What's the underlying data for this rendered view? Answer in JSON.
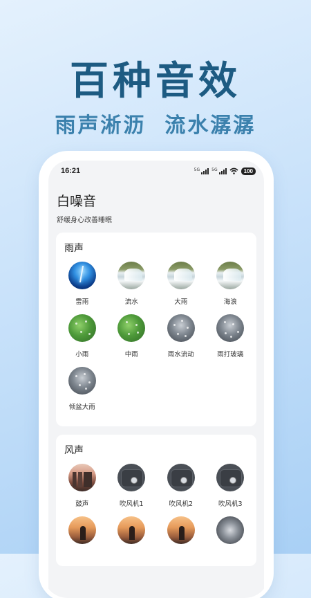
{
  "promo": {
    "headline": "百种音效",
    "subline": "雨声淅沥  流水潺潺"
  },
  "status_bar": {
    "time": "16:21",
    "signal_1_label": "5G",
    "signal_2_label": "5G",
    "battery": "100"
  },
  "app": {
    "title": "白噪音",
    "subtitle": "舒缓身心改善睡眠"
  },
  "sections": [
    {
      "title": "雨声",
      "items": [
        {
          "label": "雷雨",
          "icon": "thunderstorm-thumbnail"
        },
        {
          "label": "流水",
          "icon": "waterfall-thumbnail"
        },
        {
          "label": "大雨",
          "icon": "waterfall-thumbnail"
        },
        {
          "label": "海浪",
          "icon": "waterfall-thumbnail"
        },
        {
          "label": "小雨",
          "icon": "green-leaf-thumbnail"
        },
        {
          "label": "中雨",
          "icon": "green-leaf-thumbnail"
        },
        {
          "label": "雨水流动",
          "icon": "rain-glass-thumbnail"
        },
        {
          "label": "雨打玻璃",
          "icon": "rain-glass-thumbnail"
        },
        {
          "label": "倾盆大雨",
          "icon": "rain-glass-thumbnail"
        }
      ]
    },
    {
      "title": "风声",
      "items": [
        {
          "label": "鼓声",
          "icon": "city-sunset-thumbnail"
        },
        {
          "label": "吹风机1",
          "icon": "hair-dryer-thumbnail"
        },
        {
          "label": "吹风机2",
          "icon": "hair-dryer-thumbnail"
        },
        {
          "label": "吹风机3",
          "icon": "hair-dryer-thumbnail"
        },
        {
          "label": "",
          "icon": "sunset-person-thumbnail"
        },
        {
          "label": "",
          "icon": "sunset-person-thumbnail"
        },
        {
          "label": "",
          "icon": "sunset-person-thumbnail"
        },
        {
          "label": "",
          "icon": "motorcycle-thumbnail"
        }
      ]
    }
  ],
  "colors": {
    "headline": "#1d5b82",
    "subline": "#3b81ad",
    "background_top": "#e4f1fd",
    "background_bottom": "#a9d0f5",
    "card": "#ffffff",
    "screen_bg": "#f3f4f6"
  }
}
